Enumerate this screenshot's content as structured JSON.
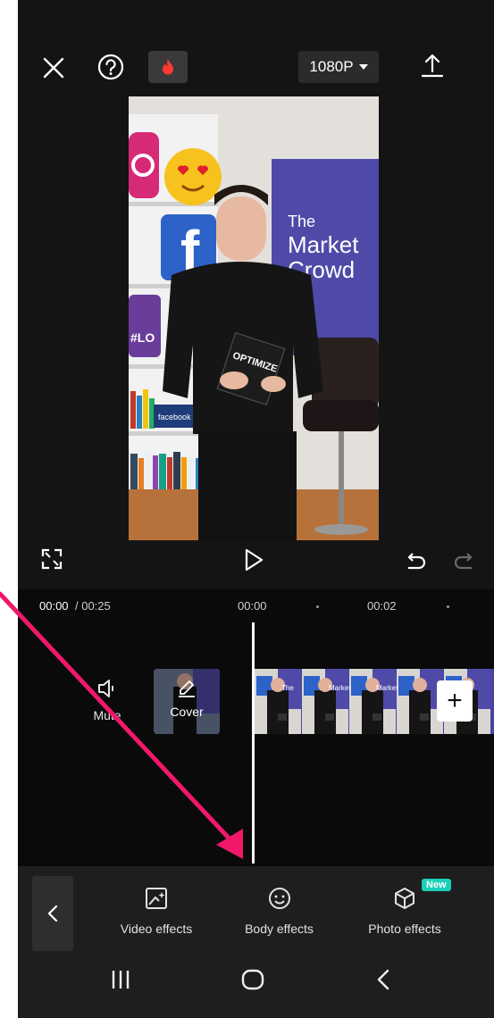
{
  "toolbar": {
    "close_icon": "close-icon",
    "help_icon": "help-icon",
    "fire_icon": "fire-icon",
    "resolution_label": "1080P",
    "export_icon": "export-icon"
  },
  "video_scene": {
    "banner_line1": "The",
    "banner_line2": "Market",
    "banner_line3": "Crowd",
    "book_title": "OPTIMIZE",
    "sign_text": "#LO",
    "fb_sign": "facebook"
  },
  "playback": {
    "fullscreen_icon": "fullscreen-icon",
    "play_icon": "play-icon",
    "undo_icon": "undo-icon",
    "redo_icon": "redo-icon"
  },
  "timeline": {
    "current_time": "00:00",
    "total_time": "/ 00:25",
    "tick_1": "00:00",
    "tick_2": "00:02",
    "mute_label": "Mute",
    "cover_label": "Cover",
    "add_label": "+"
  },
  "effects_bar": {
    "back_icon": "chevron-left-icon",
    "items": [
      {
        "label": "Video effects",
        "icon": "video-effects-icon"
      },
      {
        "label": "Body effects",
        "icon": "body-effects-icon"
      },
      {
        "label": "Photo effects",
        "icon": "photo-effects-icon",
        "badge": "New"
      }
    ]
  },
  "system_nav": {
    "recents_icon": "recents-icon",
    "home_icon": "home-icon",
    "back_icon": "back-icon"
  },
  "colors": {
    "background": "#141414",
    "annotation_arrow": "#f0186a",
    "new_badge": "#18d0b8",
    "banner_purple": "#4f4aa8"
  }
}
